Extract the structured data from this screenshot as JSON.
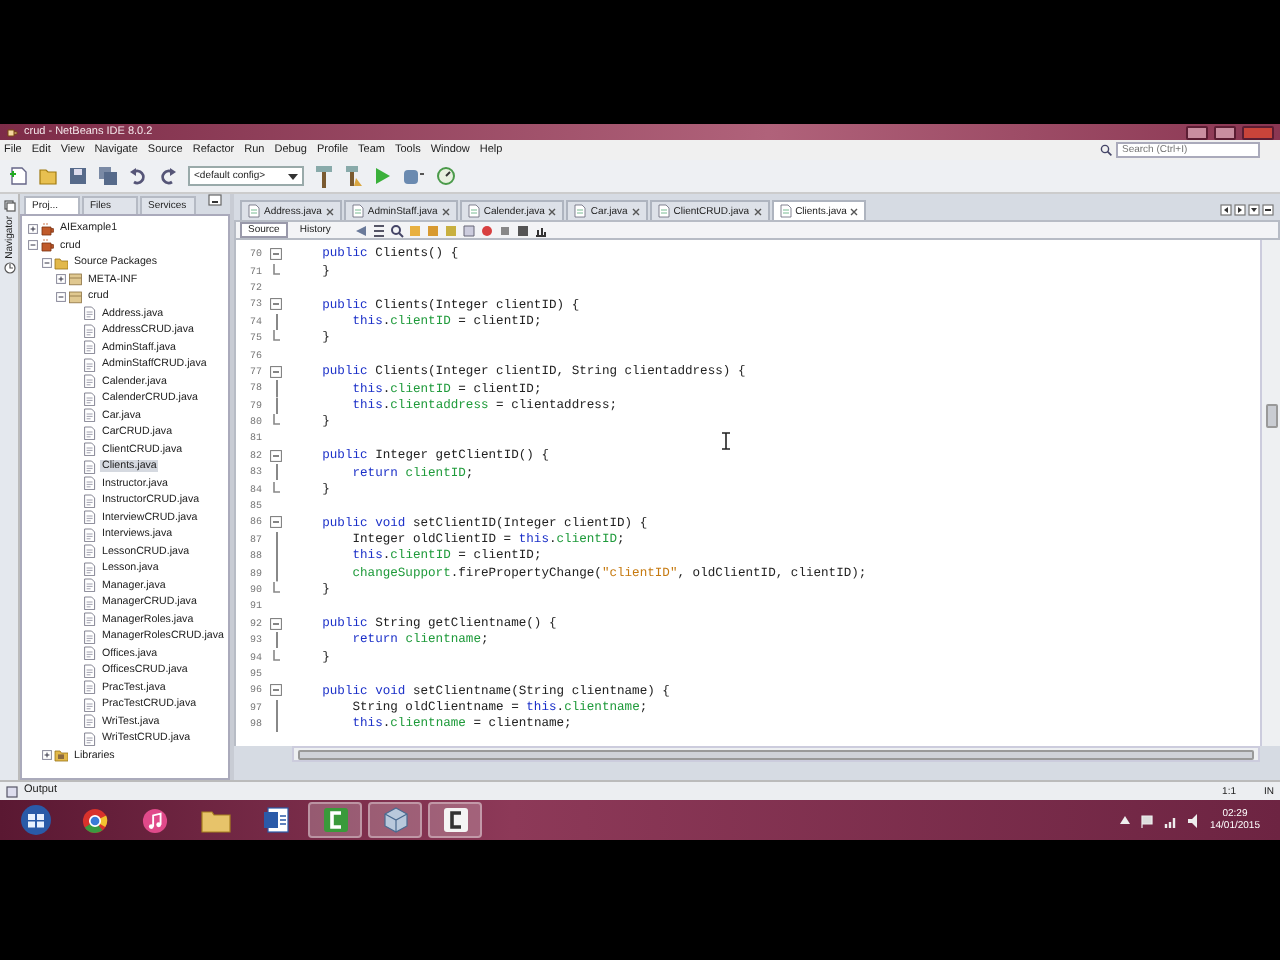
{
  "window": {
    "title": "crud - NetBeans IDE 8.0.2"
  },
  "menu": [
    "File",
    "Edit",
    "View",
    "Navigate",
    "Source",
    "Refactor",
    "Run",
    "Debug",
    "Profile",
    "Team",
    "Tools",
    "Window",
    "Help"
  ],
  "search": {
    "placeholder": "Search (Ctrl+I)"
  },
  "toolbar": {
    "config": "<default config>"
  },
  "side_panel": {
    "navigator_label": "Navigator",
    "tabs": [
      {
        "label": "Proj...",
        "selected": true
      },
      {
        "label": "Files",
        "selected": false
      },
      {
        "label": "Services",
        "selected": false
      }
    ],
    "tree": [
      {
        "label": "AIExample1",
        "kind": "project",
        "expanded": false,
        "selected": false
      },
      {
        "label": "crud",
        "kind": "project",
        "expanded": true,
        "selected": false,
        "children": [
          {
            "label": "Source Packages",
            "kind": "folder",
            "expanded": true,
            "selected": false,
            "children": [
              {
                "label": "META-INF",
                "kind": "package",
                "expanded": false,
                "selected": false
              },
              {
                "label": "crud",
                "kind": "package",
                "expanded": true,
                "selected": false,
                "children": [
                  {
                    "label": "Address.java",
                    "kind": "file",
                    "selected": false
                  },
                  {
                    "label": "AddressCRUD.java",
                    "kind": "file",
                    "selected": false
                  },
                  {
                    "label": "AdminStaff.java",
                    "kind": "file",
                    "selected": false
                  },
                  {
                    "label": "AdminStaffCRUD.java",
                    "kind": "file",
                    "selected": false
                  },
                  {
                    "label": "Calender.java",
                    "kind": "file",
                    "selected": false
                  },
                  {
                    "label": "CalenderCRUD.java",
                    "kind": "file",
                    "selected": false
                  },
                  {
                    "label": "Car.java",
                    "kind": "file",
                    "selected": false
                  },
                  {
                    "label": "CarCRUD.java",
                    "kind": "file",
                    "selected": false
                  },
                  {
                    "label": "ClientCRUD.java",
                    "kind": "file",
                    "selected": false
                  },
                  {
                    "label": "Clients.java",
                    "kind": "file",
                    "selected": true
                  },
                  {
                    "label": "Instructor.java",
                    "kind": "file",
                    "selected": false
                  },
                  {
                    "label": "InstructorCRUD.java",
                    "kind": "file",
                    "selected": false
                  },
                  {
                    "label": "InterviewCRUD.java",
                    "kind": "file",
                    "selected": false
                  },
                  {
                    "label": "Interviews.java",
                    "kind": "file",
                    "selected": false
                  },
                  {
                    "label": "LessonCRUD.java",
                    "kind": "file",
                    "selected": false
                  },
                  {
                    "label": "Lesson.java",
                    "kind": "file",
                    "selected": false
                  },
                  {
                    "label": "Manager.java",
                    "kind": "file",
                    "selected": false
                  },
                  {
                    "label": "ManagerCRUD.java",
                    "kind": "file",
                    "selected": false
                  },
                  {
                    "label": "ManagerRoles.java",
                    "kind": "file",
                    "selected": false
                  },
                  {
                    "label": "ManagerRolesCRUD.java",
                    "kind": "file",
                    "selected": false
                  },
                  {
                    "label": "Offices.java",
                    "kind": "file",
                    "selected": false
                  },
                  {
                    "label": "OfficesCRUD.java",
                    "kind": "file",
                    "selected": false
                  },
                  {
                    "label": "PracTest.java",
                    "kind": "file",
                    "selected": false
                  },
                  {
                    "label": "PracTestCRUD.java",
                    "kind": "file",
                    "selected": false
                  },
                  {
                    "label": "WriTest.java",
                    "kind": "file",
                    "selected": false
                  },
                  {
                    "label": "WriTestCRUD.java",
                    "kind": "file",
                    "selected": false
                  }
                ]
              }
            ]
          },
          {
            "label": "Libraries",
            "kind": "library",
            "expanded": false,
            "selected": false
          }
        ]
      }
    ]
  },
  "editor": {
    "tabs": [
      {
        "label": "Address.java",
        "selected": false
      },
      {
        "label": "AdminStaff.java",
        "selected": false
      },
      {
        "label": "Calender.java",
        "selected": false
      },
      {
        "label": "Car.java",
        "selected": false
      },
      {
        "label": "ClientCRUD.java",
        "selected": false
      },
      {
        "label": "Clients.java",
        "selected": true
      }
    ],
    "view_tabs": [
      {
        "label": "Source",
        "selected": true
      },
      {
        "label": "History",
        "selected": false
      }
    ],
    "lines": [
      {
        "number": "70",
        "kind": "open",
        "tokens": [
          {
            "kind": "keyword",
            "text": "    public"
          },
          {
            "kind": "plain",
            "text": " Clients() {"
          }
        ]
      },
      {
        "number": "71",
        "kind": "close",
        "tokens": [
          {
            "kind": "plain",
            "text": "    }"
          }
        ]
      },
      {
        "number": "72",
        "kind": "body"
      },
      {
        "number": "73",
        "kind": "open",
        "tokens": [
          {
            "kind": "keyword",
            "text": "    public"
          },
          {
            "kind": "plain",
            "text": " Clients(Integer clientID) {"
          }
        ]
      },
      {
        "number": "74",
        "kind": "body",
        "tokens": [
          {
            "kind": "keyword",
            "text": "        this"
          },
          {
            "kind": "plain",
            "text": "."
          },
          {
            "kind": "field",
            "text": "clientID"
          },
          {
            "kind": "plain",
            "text": " = clientID;"
          }
        ]
      },
      {
        "number": "75",
        "kind": "close",
        "tokens": [
          {
            "kind": "plain",
            "text": "    }"
          }
        ]
      },
      {
        "number": "76",
        "kind": "body"
      },
      {
        "number": "77",
        "kind": "open",
        "tokens": [
          {
            "kind": "keyword",
            "text": "    public"
          },
          {
            "kind": "plain",
            "text": " Clients(Integer clientID, String clientaddress) {"
          }
        ]
      },
      {
        "number": "78",
        "kind": "body",
        "tokens": [
          {
            "kind": "keyword",
            "text": "        this"
          },
          {
            "kind": "plain",
            "text": "."
          },
          {
            "kind": "field",
            "text": "clientID"
          },
          {
            "kind": "plain",
            "text": " = clientID;"
          }
        ]
      },
      {
        "number": "79",
        "kind": "body",
        "tokens": [
          {
            "kind": "keyword",
            "text": "        this"
          },
          {
            "kind": "plain",
            "text": "."
          },
          {
            "kind": "field",
            "text": "clientaddress"
          },
          {
            "kind": "plain",
            "text": " = clientaddress;"
          }
        ]
      },
      {
        "number": "80",
        "kind": "close",
        "tokens": [
          {
            "kind": "plain",
            "text": "    }"
          }
        ]
      },
      {
        "number": "81",
        "kind": "body"
      },
      {
        "number": "82",
        "kind": "open",
        "tokens": [
          {
            "kind": "keyword",
            "text": "    public"
          },
          {
            "kind": "plain",
            "text": " Integer getClientID() {"
          }
        ]
      },
      {
        "number": "83",
        "kind": "body",
        "tokens": [
          {
            "kind": "keyword",
            "text": "        return "
          },
          {
            "kind": "field",
            "text": "clientID"
          },
          {
            "kind": "plain",
            "text": ";"
          }
        ]
      },
      {
        "number": "84",
        "kind": "close",
        "tokens": [
          {
            "kind": "plain",
            "text": "    }"
          }
        ]
      },
      {
        "number": "85",
        "kind": "body"
      },
      {
        "number": "86",
        "kind": "open",
        "tokens": [
          {
            "kind": "keyword",
            "text": "    public void"
          },
          {
            "kind": "plain",
            "text": " setClientID(Integer clientID) {"
          }
        ]
      },
      {
        "number": "87",
        "kind": "body",
        "tokens": [
          {
            "kind": "plain",
            "text": "        Integer oldClientID = "
          },
          {
            "kind": "keyword",
            "text": "this"
          },
          {
            "kind": "plain",
            "text": "."
          },
          {
            "kind": "field",
            "text": "clientID"
          },
          {
            "kind": "plain",
            "text": ";"
          }
        ]
      },
      {
        "number": "88",
        "kind": "body",
        "tokens": [
          {
            "kind": "keyword",
            "text": "        this"
          },
          {
            "kind": "plain",
            "text": "."
          },
          {
            "kind": "field",
            "text": "clientID"
          },
          {
            "kind": "plain",
            "text": " = clientID;"
          }
        ]
      },
      {
        "number": "89",
        "kind": "body",
        "tokens": [
          {
            "kind": "field",
            "text": "        changeSupport"
          },
          {
            "kind": "plain",
            "text": ".firePropertyChange("
          },
          {
            "kind": "string",
            "text": "\"clientID\""
          },
          {
            "kind": "plain",
            "text": ", oldClientID, clientID);"
          }
        ]
      },
      {
        "number": "90",
        "kind": "close",
        "tokens": [
          {
            "kind": "plain",
            "text": "    }"
          }
        ]
      },
      {
        "number": "91",
        "kind": "body"
      },
      {
        "number": "92",
        "kind": "open",
        "tokens": [
          {
            "kind": "keyword",
            "text": "    public"
          },
          {
            "kind": "plain",
            "text": " String getClientname() {"
          }
        ]
      },
      {
        "number": "93",
        "kind": "body",
        "tokens": [
          {
            "kind": "keyword",
            "text": "        return "
          },
          {
            "kind": "field",
            "text": "clientname"
          },
          {
            "kind": "plain",
            "text": ";"
          }
        ]
      },
      {
        "number": "94",
        "kind": "close",
        "tokens": [
          {
            "kind": "plain",
            "text": "    }"
          }
        ]
      },
      {
        "number": "95",
        "kind": "body"
      },
      {
        "number": "96",
        "kind": "open",
        "tokens": [
          {
            "kind": "keyword",
            "text": "    public void"
          },
          {
            "kind": "plain",
            "text": " setClientname(String clientname) {"
          }
        ]
      },
      {
        "number": "97",
        "kind": "body",
        "tokens": [
          {
            "kind": "plain",
            "text": "        String oldClientname = "
          },
          {
            "kind": "keyword",
            "text": "this"
          },
          {
            "kind": "plain",
            "text": "."
          },
          {
            "kind": "field",
            "text": "clientname"
          },
          {
            "kind": "plain",
            "text": ";"
          }
        ]
      },
      {
        "number": "98",
        "kind": "body",
        "tokens": [
          {
            "kind": "keyword",
            "text": "        this"
          },
          {
            "kind": "plain",
            "text": "."
          },
          {
            "kind": "field",
            "text": "clientname"
          },
          {
            "kind": "plain",
            "text": " = clientname;"
          }
        ]
      }
    ]
  },
  "output": {
    "label": "Output"
  },
  "status_bar": {
    "position": "1:1",
    "mode": "IN"
  },
  "taskbar": {
    "time": "02:29",
    "date": "14/01/2015"
  }
}
